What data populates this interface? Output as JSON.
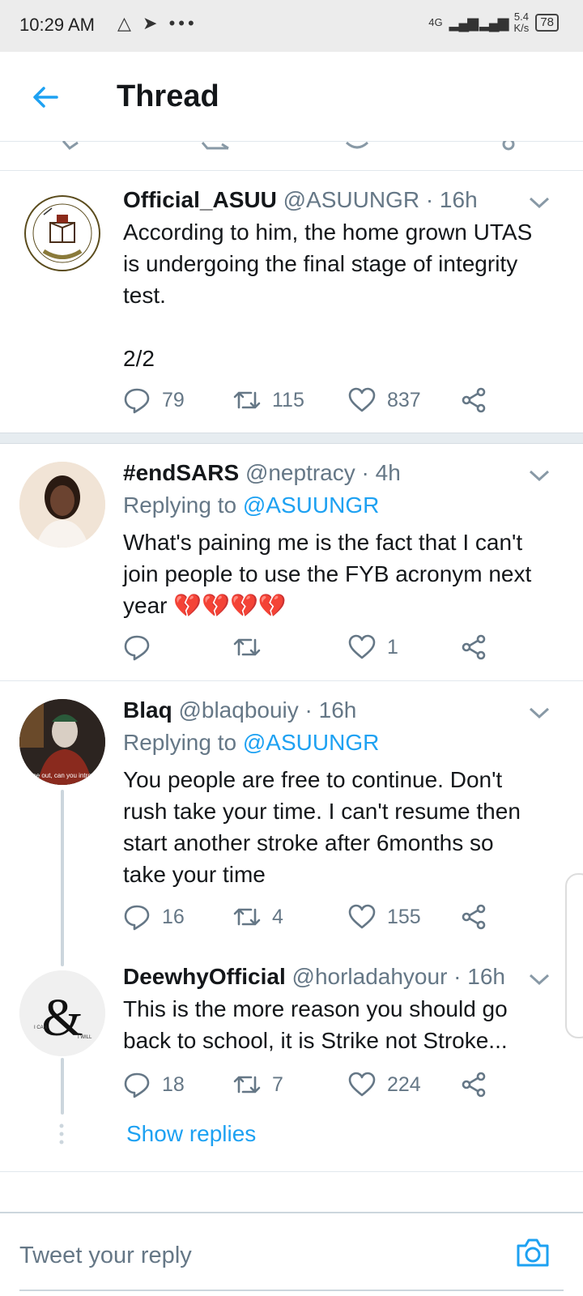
{
  "status_bar": {
    "time": "10:29 AM",
    "icons": "△ ➤ •••",
    "network_type": "4G",
    "speed_top": "5.4",
    "speed_bottom": "K/s",
    "battery": "78"
  },
  "header": {
    "title": "Thread"
  },
  "tweets": [
    {
      "name": "Official_ASUU",
      "meta": "@ASUUNGR · 16h",
      "body_lines": [
        "According to him, the home grown UTAS",
        "is undergoing the final stage of integrity",
        "test.",
        "",
        "2/2"
      ],
      "replies": "79",
      "retweets": "115",
      "likes": "837"
    },
    {
      "name": "#endSARS",
      "meta": "@neptracy · 4h",
      "replying_prefix": "Replying to",
      "replying_handle": "@ASUUNGR",
      "body_lines": [
        "What's paining me is the fact that I can't",
        "join people to use the FYB acronym next",
        "year 💔💔💔💔"
      ],
      "replies": "",
      "retweets": "",
      "likes": "1"
    },
    {
      "name": "Blaq",
      "meta": "@blaqbouiy · 16h",
      "replying_prefix": "Replying to",
      "replying_handle": "@ASUUNGR",
      "avatar_caption": "me out, can you intro",
      "body_lines": [
        "You people are free to continue. Don't",
        "rush take your time. I can't resume then",
        "start another stroke after 6months so",
        "take your time"
      ],
      "replies": "16",
      "retweets": "4",
      "likes": "155"
    },
    {
      "name": "DeewhyOfficial",
      "meta": "@horladahyour · 16h",
      "body_lines": [
        "This is the more reason you should go",
        "back to school, it is Strike not Stroke..."
      ],
      "replies": "18",
      "retweets": "7",
      "likes": "224"
    }
  ],
  "show_replies": "Show replies",
  "reply_placeholder": "Tweet your reply",
  "colors": {
    "accent": "#1da1f2",
    "secondary_text": "#657786",
    "text": "#14171a"
  }
}
